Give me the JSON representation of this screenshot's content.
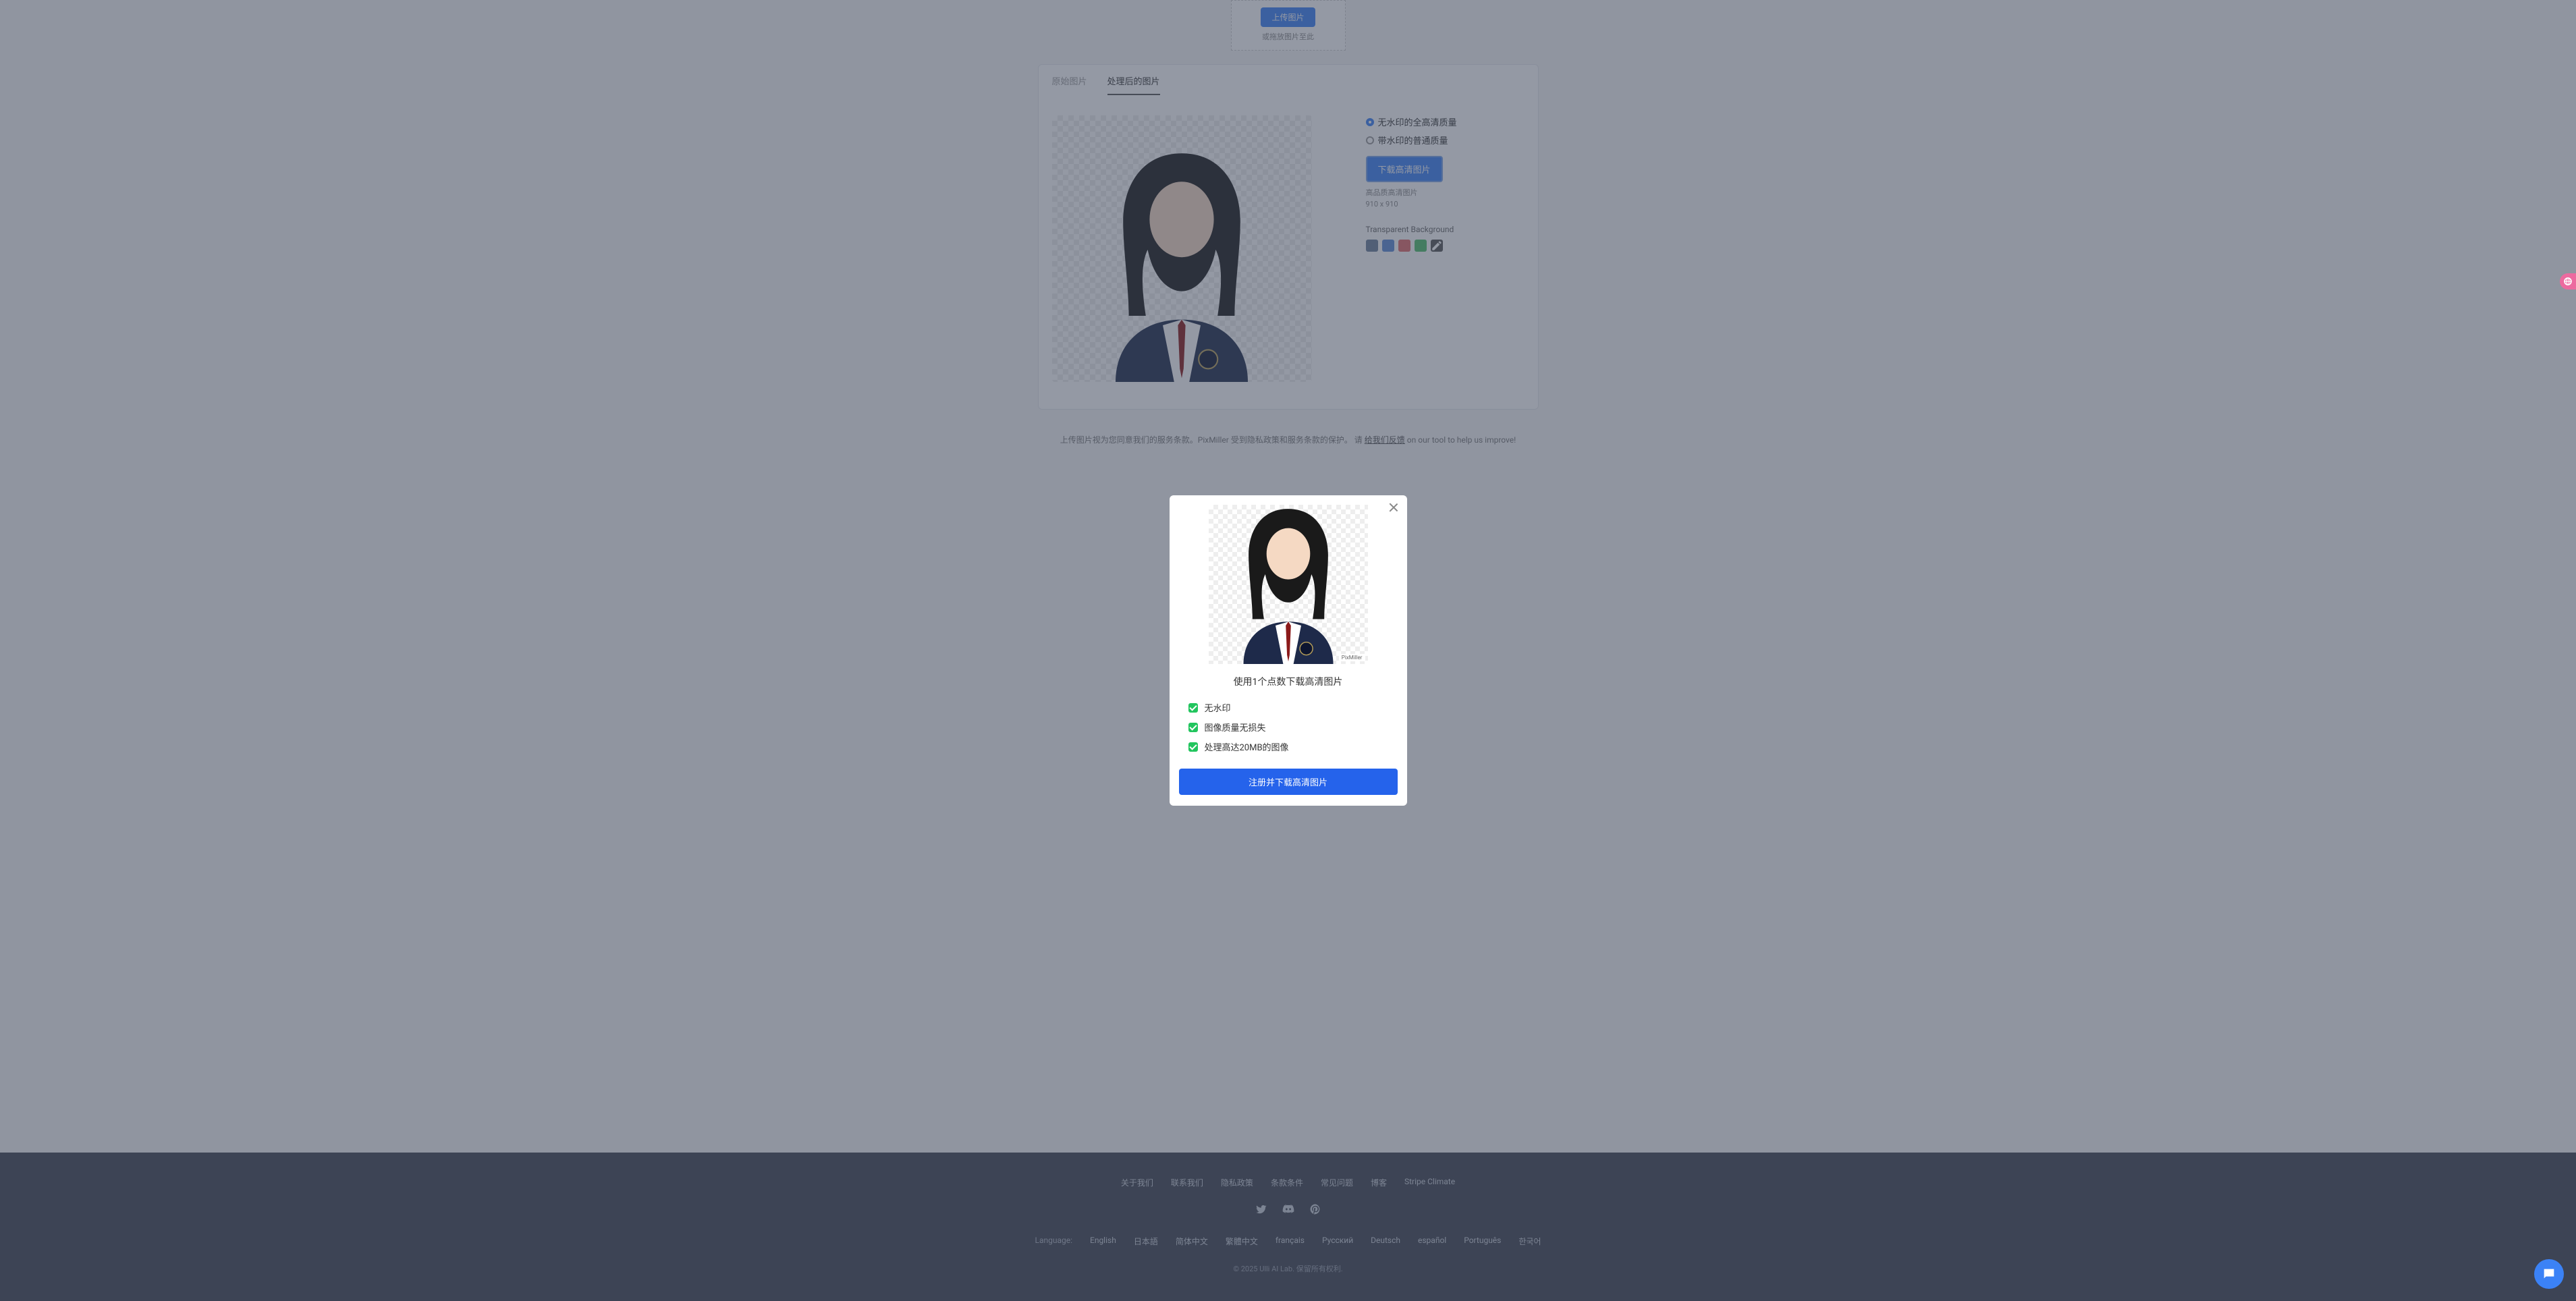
{
  "upload": {
    "button": "上传图片",
    "hint": "或拖放图片至此"
  },
  "tabs": {
    "original": "原始图片",
    "processed": "处理后的图片"
  },
  "options": {
    "hd_nowm": "无水印的全高清质量",
    "normal_wm": "带水印的普通质量",
    "download_btn": "下载高清图片",
    "line1": "高品质高清图片",
    "line2": "910 x 910",
    "bg_label": "Transparent Background"
  },
  "swatches": [
    "#6b7f99",
    "#5b8bd6",
    "#e36a6a",
    "#4fbf6b",
    "#555"
  ],
  "disclaimer": {
    "pre": "上传图片视为您同意我们的服务条款。PixMiller 受到隐私政策和服务条款的保护。 请 ",
    "link": "给我们反馈",
    "post": " on our tool to help us improve!"
  },
  "footer": {
    "links": [
      "关于我们",
      "联系我们",
      "隐私政策",
      "条款条件",
      "常见问题",
      "博客",
      "Stripe Climate"
    ],
    "lang_label": "Language:",
    "langs": [
      "English",
      "日本語",
      "简体中文",
      "繁體中文",
      "français",
      "Русский",
      "Deutsch",
      "español",
      "Português",
      "한국어"
    ],
    "copyright": "© 2025 Ulli AI Lab. 保留所有权利."
  },
  "modal": {
    "watermark": "PixMiller",
    "title": "使用1个点数下载高清图片",
    "features": [
      "无水印",
      "图像质量无损失",
      "处理高达20MB的图像"
    ],
    "cta": "注册并下载高清图片"
  }
}
